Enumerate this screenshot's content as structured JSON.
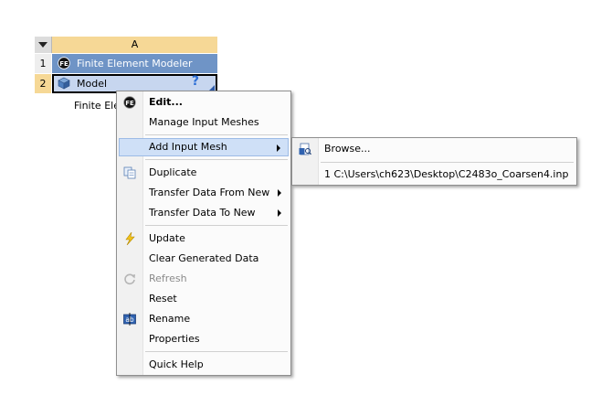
{
  "system": {
    "column_header": "A",
    "rows": [
      {
        "num": "1",
        "label": "Finite Element Modeler",
        "icon": "fe-icon"
      },
      {
        "num": "2",
        "label": "Model",
        "icon": "model-cube-icon",
        "status": "?"
      }
    ],
    "caption": "Finite Ele"
  },
  "context_menu": {
    "items": [
      {
        "label": "Edit...",
        "icon": "fe-icon",
        "bold": true
      },
      {
        "label": "Manage Input Meshes"
      },
      {
        "label": "Add Input Mesh",
        "submenu": true,
        "highlighted": true
      },
      {
        "label": "Duplicate",
        "icon": "duplicate-icon"
      },
      {
        "label": "Transfer Data From New",
        "submenu": true
      },
      {
        "label": "Transfer Data To New",
        "submenu": true
      },
      {
        "label": "Update",
        "icon": "lightning-icon"
      },
      {
        "label": "Clear Generated Data"
      },
      {
        "label": "Refresh",
        "icon": "refresh-icon",
        "disabled": true
      },
      {
        "label": "Reset"
      },
      {
        "label": "Rename",
        "icon": "rename-icon"
      },
      {
        "label": "Properties"
      },
      {
        "label": "Quick Help"
      }
    ]
  },
  "submenu": {
    "items": [
      {
        "label": "Browse...",
        "icon": "browse-file-icon"
      },
      {
        "label": "1 C:\\Users\\ch623\\Desktop\\C2483o_Coarsen4.inp"
      }
    ]
  },
  "colors": {
    "row_blue": "#6f94c6",
    "row_selected": "#c7d6ef",
    "header_gold": "#f6d896",
    "menu_highlight": "#cfe0f7"
  }
}
